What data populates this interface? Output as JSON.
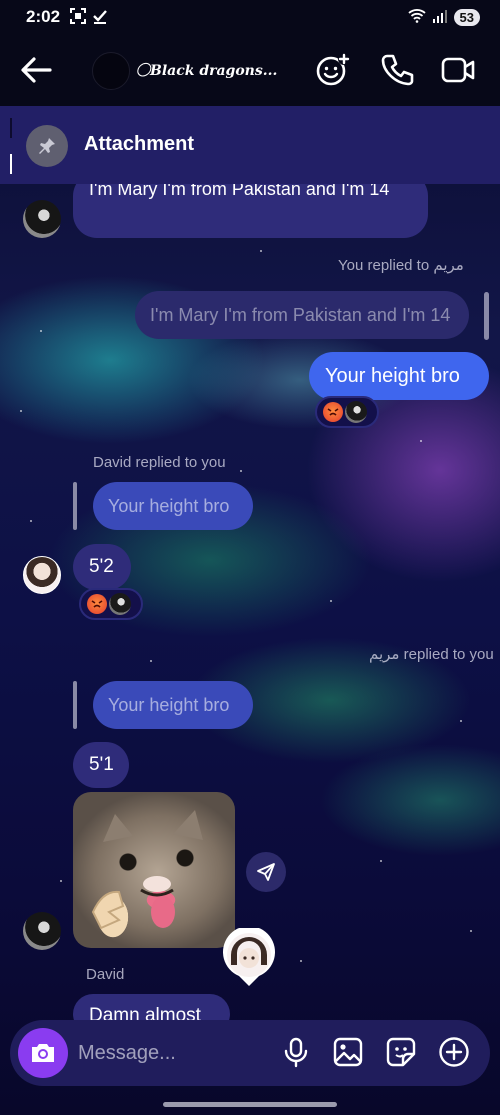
{
  "status_bar": {
    "time": "2:02",
    "battery": "53"
  },
  "header": {
    "title": "⃝Black dragons..."
  },
  "pinned": {
    "label": "Attachment"
  },
  "messages": {
    "m1_text": "I'm Mary I'm from Pakistan and I'm 14",
    "reply1_meta": "You replied to مريم",
    "reply1_quote": "I'm Mary I'm from Pakistan and I'm 14",
    "out1_text": "Your height bro",
    "reply2_meta": "David replied to you",
    "reply2_quote": "Your height bro",
    "in2_text": "5'2",
    "reply3_meta": "مريم replied to you",
    "reply3_quote": "Your height bro",
    "in3_text": "5'1",
    "sender_name": "David",
    "in4_text": "Damn almost"
  },
  "composer": {
    "placeholder": "Message..."
  }
}
